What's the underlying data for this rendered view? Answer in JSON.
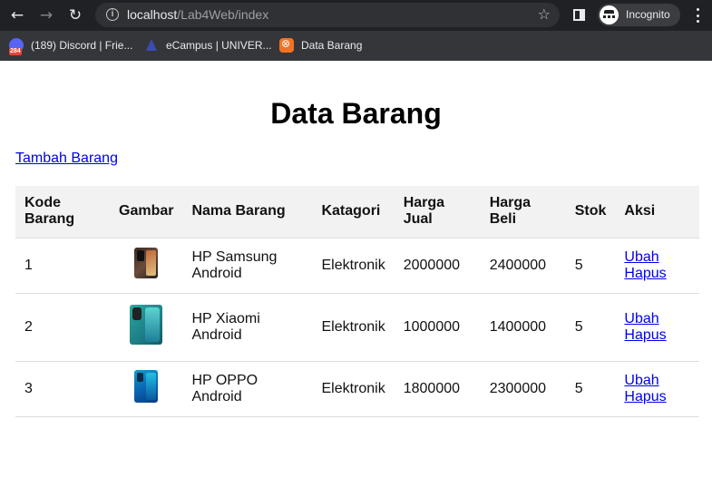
{
  "browser": {
    "url_host": "localhost",
    "url_path": "/Lab4Web/index",
    "incognito_label": "Incognito",
    "bookmarks": [
      {
        "label": "(189) Discord | Frie...",
        "icon": "discord-icon",
        "badge": "284"
      },
      {
        "label": "eCampus | UNIVER...",
        "icon": "ecampus-icon"
      },
      {
        "label": "Data Barang",
        "icon": "xampp-icon"
      }
    ]
  },
  "page": {
    "title": "Data Barang",
    "add_link": "Tambah Barang"
  },
  "table": {
    "headers": {
      "kode_1": "Kode",
      "kode_2": "Barang",
      "gambar": "Gambar",
      "nama": "Nama Barang",
      "kategori": "Katagori",
      "jual_1": "Harga",
      "jual_2": "Jual",
      "beli_1": "Harga",
      "beli_2": "Beli",
      "stok": "Stok",
      "aksi": "Aksi"
    },
    "rows": [
      {
        "kode": "1",
        "nama_1": "HP Samsung",
        "nama_2": "Android",
        "kategori": "Elektronik",
        "harga_jual": "2000000",
        "harga_beli": "2400000",
        "stok": "5",
        "ubah": "Ubah",
        "hapus": "Hapus",
        "image": "phone-image"
      },
      {
        "kode": "2",
        "nama_1": "HP Xiaomi",
        "nama_2": "Android",
        "kategori": "Elektronik",
        "harga_jual": "1000000",
        "harga_beli": "1400000",
        "stok": "5",
        "ubah": "Ubah",
        "hapus": "Hapus",
        "image": "phone-image"
      },
      {
        "kode": "3",
        "nama_1": "HP OPPO",
        "nama_2": "Android",
        "kategori": "Elektronik",
        "harga_jual": "1800000",
        "harga_beli": "2300000",
        "stok": "5",
        "ubah": "Ubah",
        "hapus": "Hapus",
        "image": "phone-image"
      }
    ]
  },
  "colors": {
    "link": "#0000ee",
    "header_bg": "#f2f2f2",
    "chrome_bg": "#202124"
  }
}
